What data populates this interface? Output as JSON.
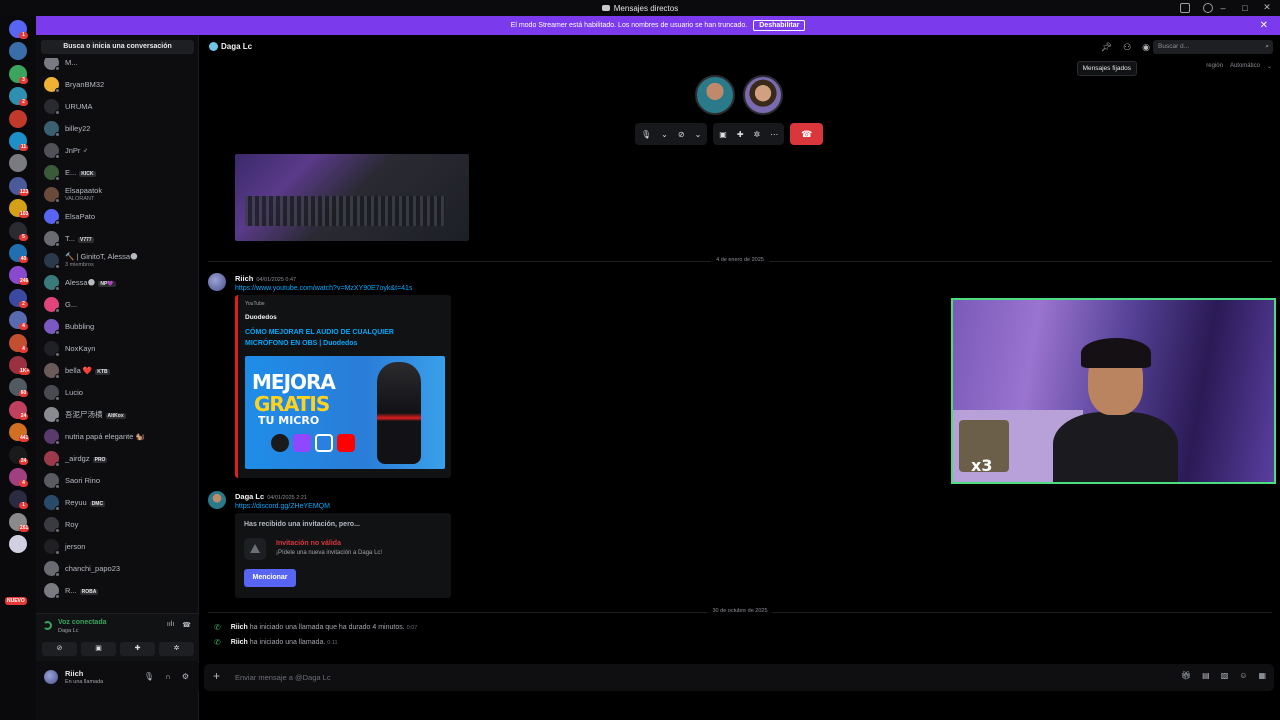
{
  "window": {
    "title": "Mensajes directos"
  },
  "banner": {
    "text": "El modo Streamer está habilitado. Los nombres de usuario se han truncado.",
    "button": "Deshabilitar"
  },
  "rail": {
    "servers": [
      {
        "color": "#5865f2",
        "badge": "1"
      },
      {
        "color": "#3b6ea8",
        "badge": ""
      },
      {
        "color": "#3ba55d",
        "badge": "3"
      },
      {
        "color": "#2f8fb0",
        "badge": "2"
      },
      {
        "color": "#c0392b",
        "badge": ""
      },
      {
        "color": "#1e90c8",
        "badge": "11"
      },
      {
        "color": "#7a7a82",
        "badge": ""
      },
      {
        "color": "#4a5a9a",
        "badge": "123"
      },
      {
        "color": "#d4a017",
        "badge": "103"
      },
      {
        "color": "#2a2a33",
        "badge": "5"
      },
      {
        "color": "#2070b0",
        "badge": "40"
      },
      {
        "color": "#8a4ad0",
        "badge": "246"
      },
      {
        "color": "#3a4aa0",
        "badge": "2"
      },
      {
        "color": "#5a6ab0",
        "badge": "4"
      },
      {
        "color": "#c05030",
        "badge": "4"
      },
      {
        "color": "#9a3040",
        "badge": "1K+"
      },
      {
        "color": "#505a60",
        "badge": "60"
      },
      {
        "color": "#c04060",
        "badge": "24"
      },
      {
        "color": "#d07020",
        "badge": "441"
      },
      {
        "color": "#1a1a1a",
        "badge": "24"
      },
      {
        "color": "#a04080",
        "badge": "4"
      },
      {
        "color": "#2a2a40",
        "badge": "1"
      },
      {
        "color": "#8a8a8a",
        "badge": "261"
      },
      {
        "color": "#d0d0e0",
        "badge": ""
      }
    ],
    "new_label": "NUEVO"
  },
  "dm_sidebar": {
    "search": "Busca o inicia una conversación",
    "items": [
      {
        "name": "M...",
        "sub": "",
        "tag": "",
        "color": "#7a7a82"
      },
      {
        "name": "BryanBM32",
        "sub": "",
        "tag": "",
        "color": "#f0b232"
      },
      {
        "name": "URUMA",
        "sub": "",
        "tag": "",
        "color": "#2a2a33"
      },
      {
        "name": "billey22",
        "sub": "",
        "tag": "",
        "color": "#3a6070"
      },
      {
        "name": "JnPr ♂",
        "sub": "",
        "tag": "",
        "color": "#505058"
      },
      {
        "name": "E...",
        "sub": "",
        "tag": "KICK",
        "color": "#3a5a3a"
      },
      {
        "name": "Elsapaatok",
        "sub": "VALORANT",
        "tag": "",
        "color": "#6a4a3a"
      },
      {
        "name": "ElsaPato",
        "sub": "",
        "tag": "",
        "color": "#5865f2"
      },
      {
        "name": "T...",
        "sub": "",
        "tag": "V777",
        "color": "#6a6a72"
      },
      {
        "name": "🔨 | GinitoT, Alessa🌑",
        "sub": "3 miembros",
        "tag": "",
        "color": "#2a3a4a"
      },
      {
        "name": "Alessa🌑",
        "sub": "",
        "tag": "NP💜",
        "color": "#3a7a7a"
      },
      {
        "name": "G...",
        "sub": "",
        "tag": "",
        "color": "#e0457a"
      },
      {
        "name": "Bubbling",
        "sub": "",
        "tag": "",
        "color": "#7a5ac0"
      },
      {
        "name": "NoxKayn",
        "sub": "",
        "tag": "",
        "color": "#202028"
      },
      {
        "name": "bella ❤️",
        "sub": "",
        "tag": "KTB",
        "color": "#6a5a5a"
      },
      {
        "name": "Lucio",
        "sub": "",
        "tag": "",
        "color": "#4a4a52"
      },
      {
        "name": "吾泥尸汤横",
        "sub": "",
        "tag": "AltKox",
        "color": "#8a8a92"
      },
      {
        "name": "nutria papá elegante 🐿️",
        "sub": "",
        "tag": "",
        "color": "#5a3a6a"
      },
      {
        "name": "_airdgz",
        "sub": "",
        "tag": "PRO",
        "color": "#9a3a4a"
      },
      {
        "name": "Saori Rino",
        "sub": "",
        "tag": "",
        "color": "#5a5a62"
      },
      {
        "name": "Reyuu",
        "sub": "",
        "tag": "DMC",
        "color": "#2a4a6a"
      },
      {
        "name": "Roy",
        "sub": "",
        "tag": "",
        "color": "#3a3a42"
      },
      {
        "name": "jerson",
        "sub": "",
        "tag": "",
        "color": "#202024"
      },
      {
        "name": "chanchi_papo23",
        "sub": "",
        "tag": "",
        "color": "#6a6a72"
      },
      {
        "name": "R...",
        "sub": "",
        "tag": "ROBA",
        "color": "#7a7a82"
      }
    ],
    "voice": {
      "title": "Voz conectada",
      "subtitle": "Daga Lc"
    },
    "user": {
      "name": "Riich",
      "status": "En una llamada"
    }
  },
  "chat": {
    "header_name": "Daga Lc",
    "search_placeholder": "Buscar d...",
    "tooltip": "Mensajes fijados",
    "region_label": "región",
    "region_value": "Automático",
    "divider_1": "4 de enero de 2025",
    "divider_2": "30 de octubre de 2025",
    "msg1": {
      "author": "Riich",
      "time": "04/01/2025 0:47",
      "link": "https://www.youtube.com/watch?v=MzXY90E7oyk&t=41s",
      "embed": {
        "provider": "YouTube",
        "author": "Duodedos",
        "title": "CÓMO MEJORAR EL AUDIO DE CUALQUIER MICRÓFONO EN OBS | Duodedos",
        "thumb_l1": "MEJORA",
        "thumb_l2": "GRATIS",
        "thumb_l3": "TU MICRO"
      }
    },
    "msg2": {
      "author": "Daga Lc",
      "time": "04/01/2025 2:21",
      "link": "https://discord.gg/ZHeYEMQM",
      "invite": {
        "header": "Has recibido una invitación, pero...",
        "title": "Invitación no válida",
        "subtitle": "¡Pídele una nueva invitación a Daga Lc!",
        "button": "Mencionar"
      }
    },
    "log1": {
      "author": "Riich",
      "text": "ha iniciado una llamada que ha durado 4 minutos.",
      "time": "0:07"
    },
    "log2": {
      "author": "Riich",
      "text": "ha iniciado una llamada.",
      "time": "0:11"
    },
    "composer_placeholder": "Enviar mensaje a @Daga Lc"
  },
  "webcam": {
    "overlay_text": "x3"
  }
}
